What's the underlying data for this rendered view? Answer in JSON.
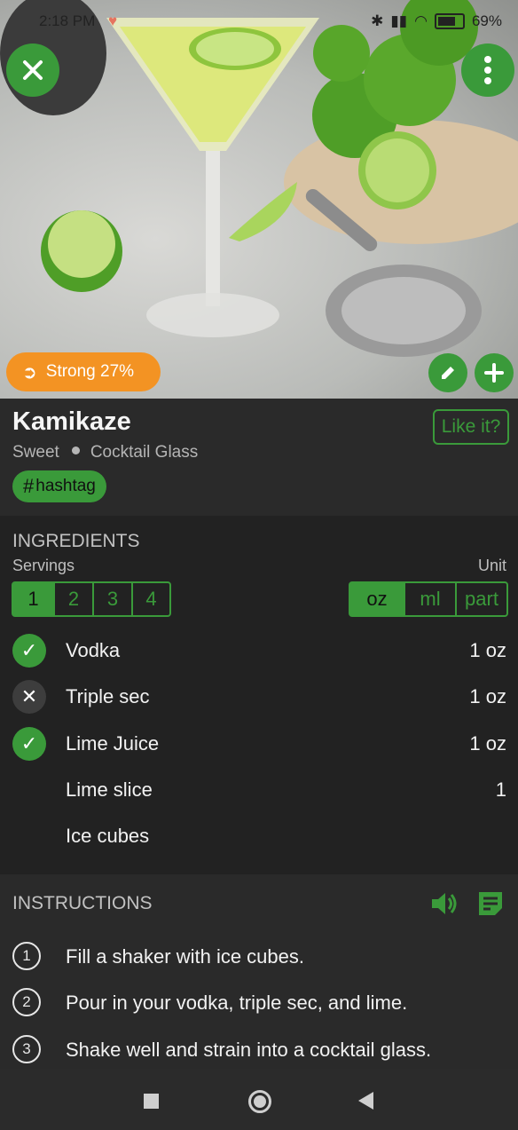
{
  "status_bar": {
    "time": "2:18 PM",
    "battery": "69%"
  },
  "hero": {
    "strength_label": "Strong 27%"
  },
  "drink": {
    "name": "Kamikaze",
    "taste": "Sweet",
    "glass": "Cocktail Glass",
    "like_label": "Like it?",
    "tag": "hashtag"
  },
  "ingredients": {
    "heading": "INGREDIENTS",
    "servings_label": "Servings",
    "unit_label": "Unit",
    "servings": [
      "1",
      "2",
      "3",
      "4"
    ],
    "servings_selected": "1",
    "units": [
      "oz",
      "ml",
      "part"
    ],
    "unit_selected": "oz",
    "items": [
      {
        "name": "Vodka",
        "amount": "1 oz",
        "status": "have"
      },
      {
        "name": "Triple sec",
        "amount": "1 oz",
        "status": "missing"
      },
      {
        "name": "Lime Juice",
        "amount": "1 oz",
        "status": "have"
      },
      {
        "name": "Lime slice",
        "amount": "1",
        "status": "none"
      },
      {
        "name": "Ice cubes",
        "amount": "",
        "status": "none"
      }
    ]
  },
  "instructions": {
    "heading": "INSTRUCTIONS",
    "steps": [
      {
        "num": "1",
        "text": "Fill a shaker with ice cubes."
      },
      {
        "num": "2",
        "text": "Pour in your vodka, triple sec, and lime."
      },
      {
        "num": "3",
        "text": "Shake well and strain into a cocktail glass."
      }
    ]
  },
  "colors": {
    "accent": "#3a9a3a",
    "strength": "#f39323",
    "background": "#1f1f1f"
  }
}
